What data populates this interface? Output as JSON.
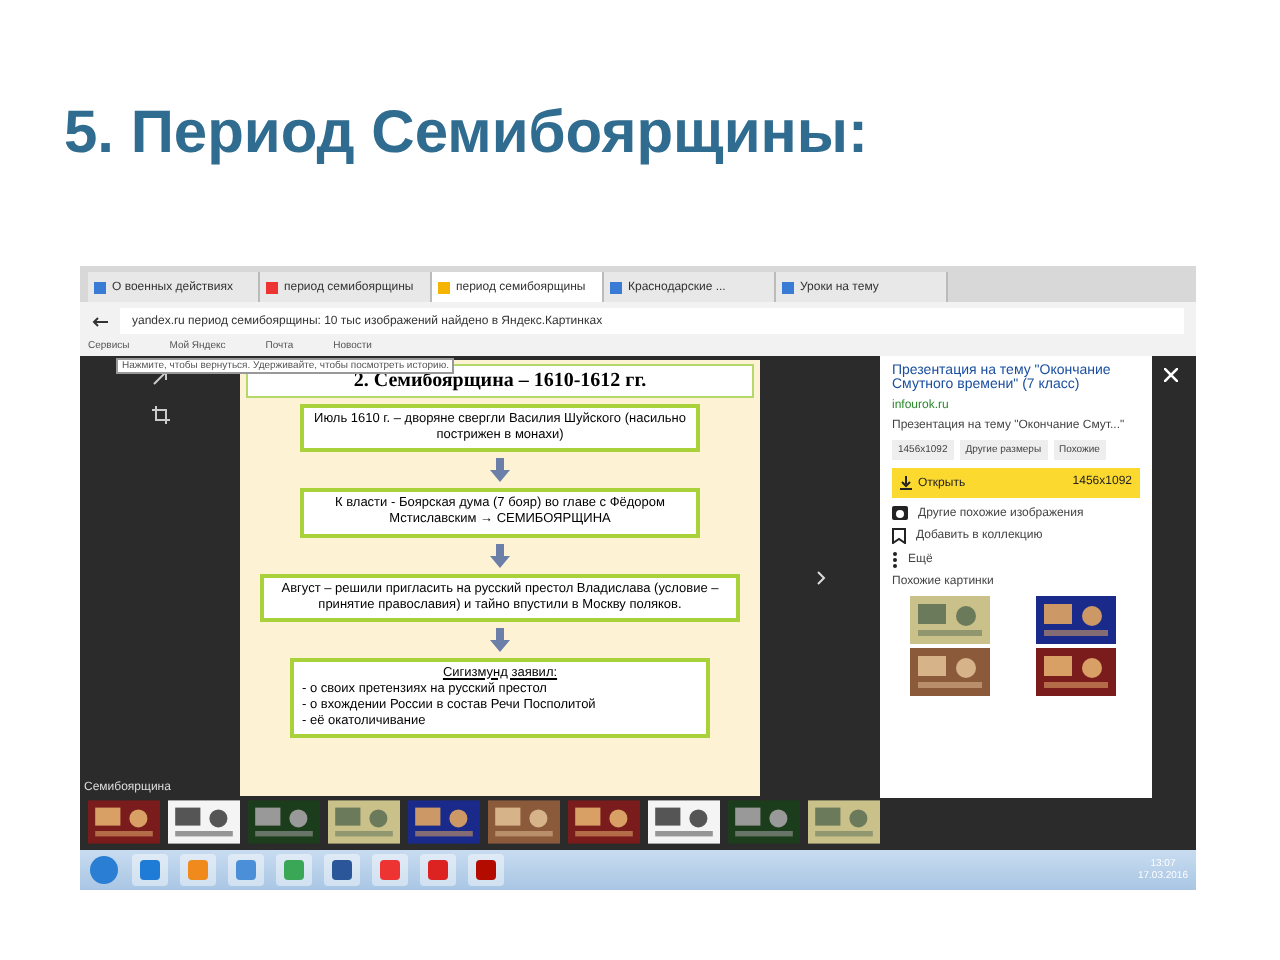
{
  "slide_title": "5. Период Семибоярщины:",
  "browser": {
    "tabs": [
      {
        "label": "О военных действиях",
        "selected": false
      },
      {
        "label": "период семибоярщины",
        "selected": false
      },
      {
        "label": "период семибоярщины",
        "selected": true
      },
      {
        "label": "Краснодарские ...",
        "selected": false
      },
      {
        "label": "Уроки на тему",
        "selected": false
      }
    ],
    "address": "yandex.ru   период семибоярщины: 10 тыс изображений найдено в Яндекс.Картинках",
    "bookmarks": [
      "Сервисы",
      "Мой Яндекс",
      "Почта",
      "Новости"
    ],
    "tooltip": "Нажмите, чтобы вернуться. Удерживайте, чтобы посмотреть историю."
  },
  "image": {
    "heading": "2. Семибоярщина – 1610-1612 гг.",
    "boxes": [
      {
        "kind": "text",
        "text": "Июль 1610 г. – дворяне свергли Василия Шуйского (насильно пострижен в монахи)"
      },
      {
        "kind": "text",
        "text": "К власти - Боярская дума (7 бояр) во главе с Фёдором Мстиславским → СЕМИБОЯРЩИНА"
      },
      {
        "kind": "text",
        "text": "Август – решили пригласить на русский престол Владислава (условие – принятие православия) и тайно впустили в Москву поляков."
      },
      {
        "kind": "list",
        "title": "Сигизмунд заявил:",
        "lines": [
          "- о своих претензиях на русский престол",
          "- о вхождении России в состав Речи Посполитой",
          "- её окатоличивание"
        ]
      }
    ]
  },
  "caption": "Семибоярщина",
  "panel": {
    "title": "Презентация на тему \"Окончание Смутного времени\" (7 класс)",
    "source": "infourok.ru",
    "description": "Презентация на тему \"Окончание Смут...\"",
    "chips": [
      "1456x1092",
      "Другие размеры",
      "Похожие"
    ],
    "open": "Открыть",
    "size": "1456x1092",
    "actions": [
      {
        "kind": "camera",
        "label": "Другие похожие изображения"
      },
      {
        "kind": "bookmark",
        "label": "Добавить в коллекцию"
      },
      {
        "kind": "more",
        "label": "Ещё"
      }
    ],
    "similar": "Похожие картинки"
  },
  "taskbar": {
    "time": "13:07",
    "date": "17.03.2016"
  }
}
